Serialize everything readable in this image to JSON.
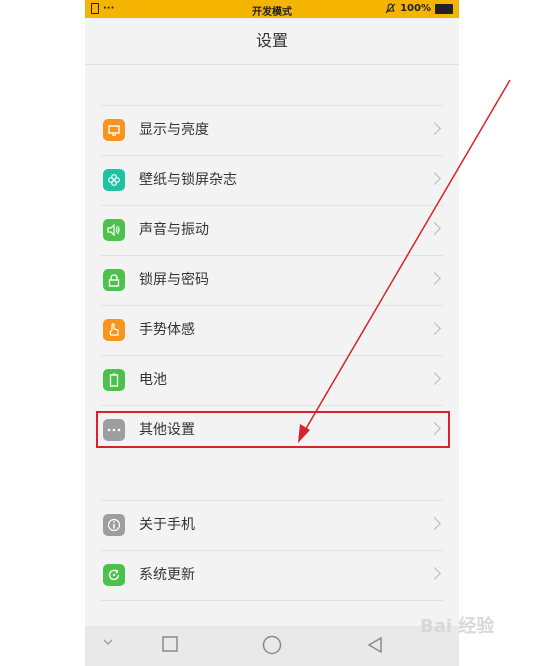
{
  "statusbar": {
    "dots": "···",
    "title": "开发模式",
    "battery": "100%"
  },
  "header": {
    "title": "设置"
  },
  "settings": [
    {
      "label": "显示与亮度",
      "icon": "display-icon",
      "color": "#f7941d"
    },
    {
      "label": "壁纸与锁屏杂志",
      "icon": "flower-icon",
      "color": "#1ec3a4"
    },
    {
      "label": "声音与振动",
      "icon": "speaker-icon",
      "color": "#4cc24c"
    },
    {
      "label": "锁屏与密码",
      "icon": "lock-icon",
      "color": "#4cc24c"
    },
    {
      "label": "手势体感",
      "icon": "hand-icon",
      "color": "#f7941d"
    },
    {
      "label": "电池",
      "icon": "battery-icon",
      "color": "#4cc24c"
    },
    {
      "label": "其他设置",
      "icon": "more-icon",
      "color": "#9e9e9e"
    }
  ],
  "settings2": [
    {
      "label": "关于手机",
      "icon": "info-icon",
      "color": "#9e9e9e"
    },
    {
      "label": "系统更新",
      "icon": "update-icon",
      "color": "#4cc24c"
    }
  ],
  "watermark": "Bai 经验"
}
